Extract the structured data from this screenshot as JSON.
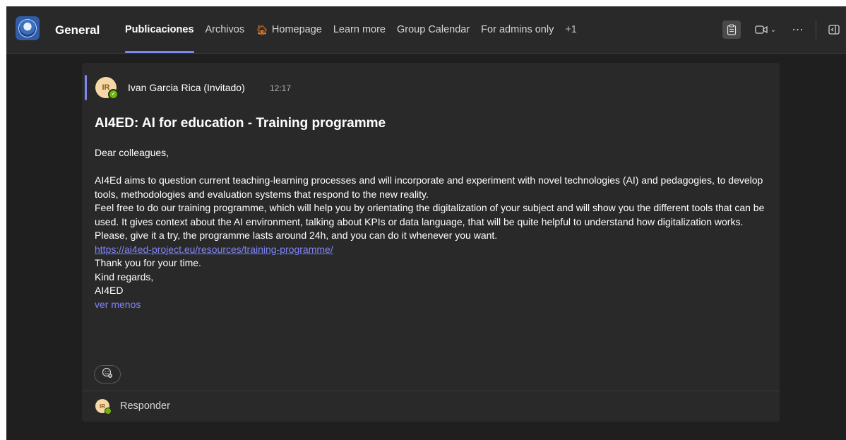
{
  "header": {
    "channel_name": "General",
    "tabs": [
      {
        "label": "Publicaciones",
        "active": true
      },
      {
        "label": "Archivos"
      },
      {
        "label": "Homepage",
        "icon": "house-icon"
      },
      {
        "label": "Learn more"
      },
      {
        "label": "Group Calendar"
      },
      {
        "label": "For admins only"
      }
    ],
    "more_tabs": "+1",
    "actions": [
      "clipboard-icon",
      "video-icon",
      "more-icon",
      "panel-icon"
    ]
  },
  "message": {
    "author_initials": "IR",
    "author": "Ivan Garcia Rica (Invitado)",
    "time": "12:17",
    "subject": "AI4ED: AI for education - Training programme",
    "greeting": "Dear colleagues,",
    "para1": "AI4Ed aims to question current teaching-learning processes and will incorporate and experiment with novel technologies (AI) and pedagogies, to develop tools, methodologies and evaluation systems that respond to the new reality.",
    "para2": "Feel free to do our training programme, which will help you by orientating the digitalization of your subject and will show you the different tools that can be used. It gives context about the AI environment, talking about KPIs or data language, that will be quite helpful to understand how digitalization works.",
    "para3": "Please, give it a try, the programme lasts around 24h, and you can do it whenever you want.",
    "link": "https://ai4ed-project.eu/resources/training-programme/",
    "thanks": "Thank you for your time.",
    "regards": "Kind regards,",
    "signature": "AI4ED",
    "see_less": "ver menos"
  },
  "reply": {
    "initials": "IR",
    "label": "Responder"
  },
  "colors": {
    "accent": "#7f85f5",
    "background": "#1f1f1f",
    "card": "#292929",
    "presence": "#6bb700"
  }
}
